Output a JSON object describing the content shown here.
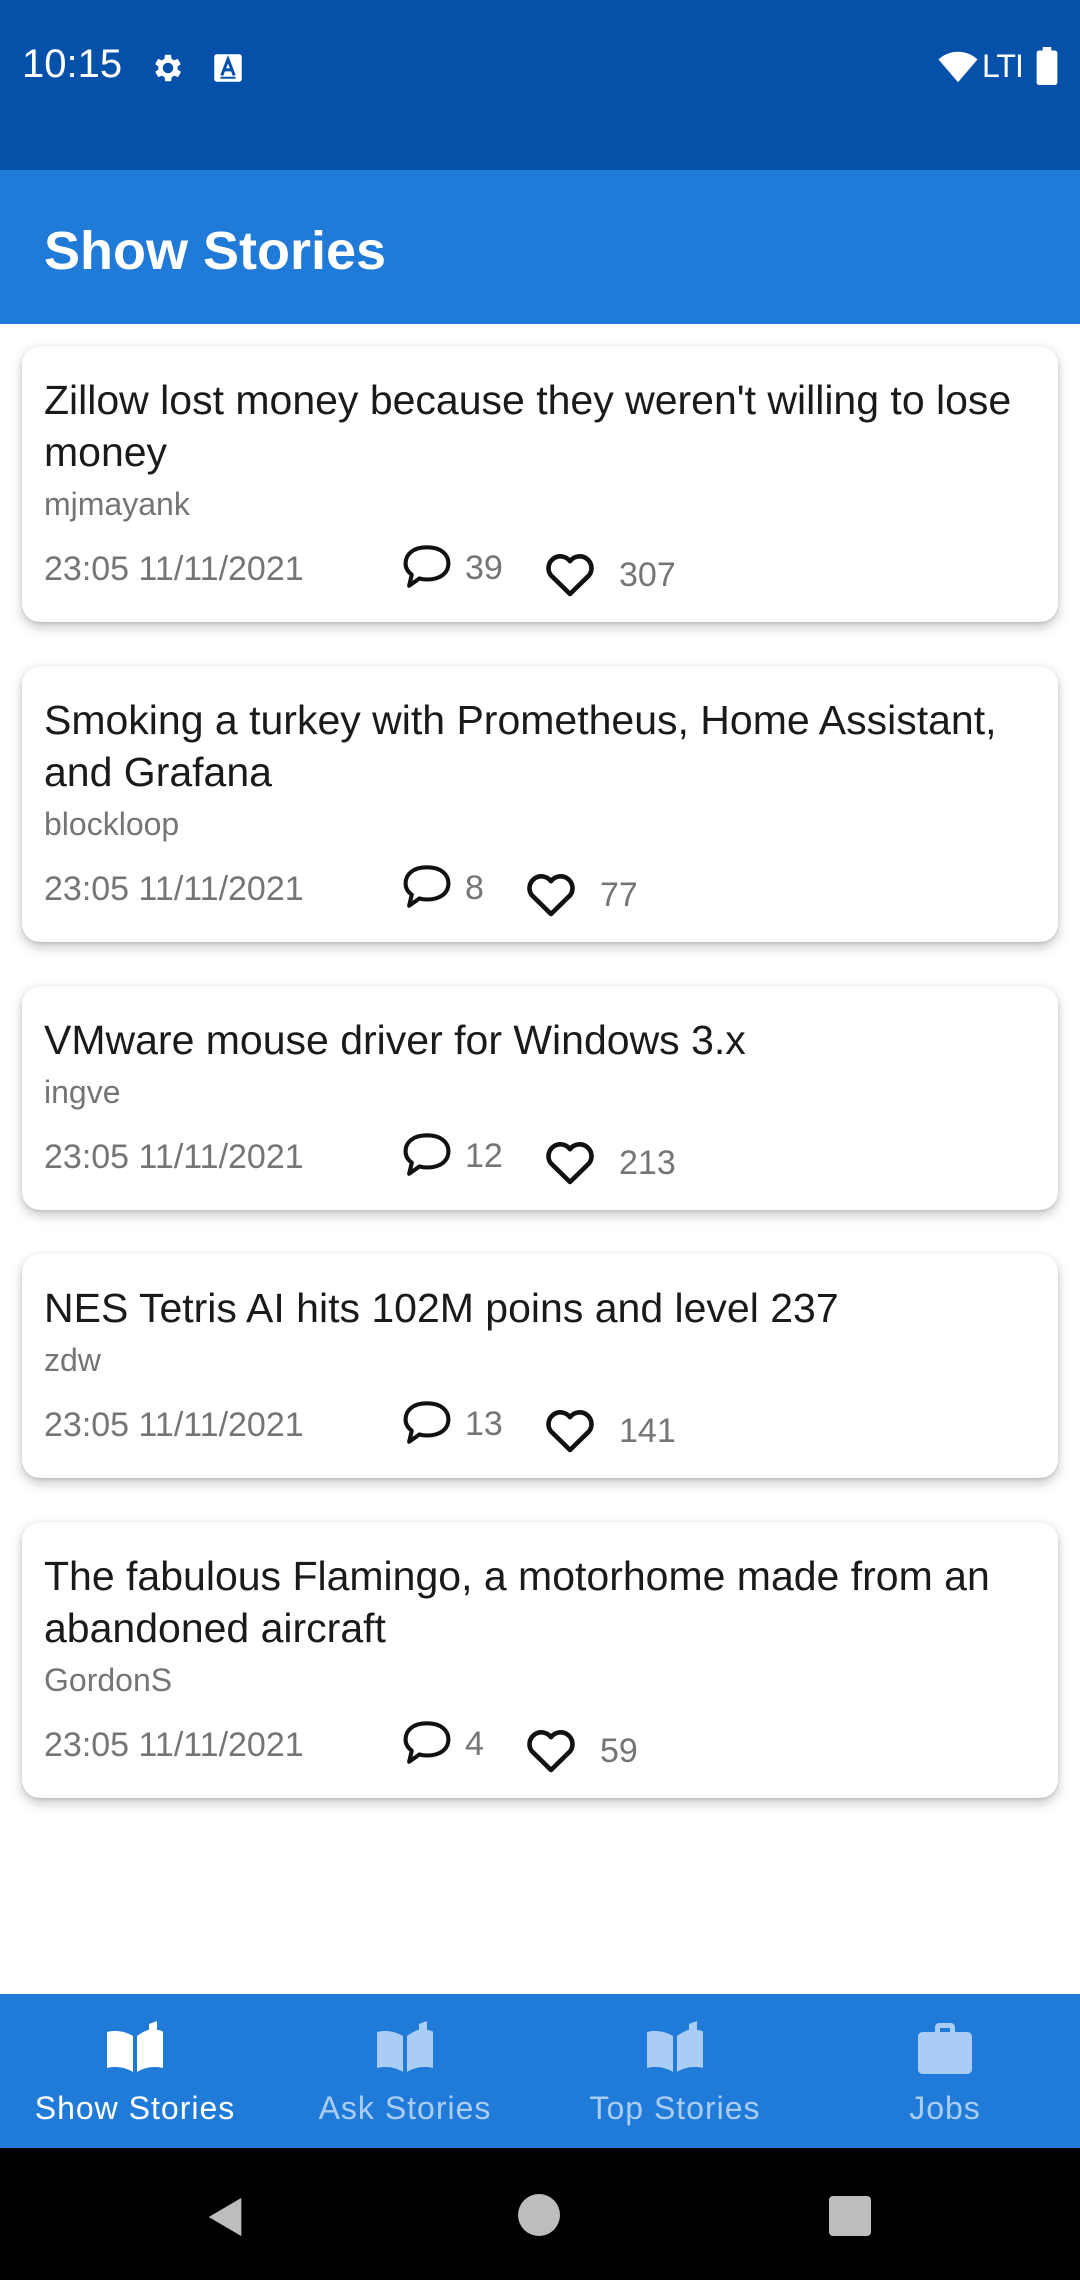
{
  "status_bar": {
    "time": "10:15",
    "network": "LTI",
    "icons": [
      "gear-icon",
      "a-box-icon",
      "wifi-icon",
      "battery-icon"
    ]
  },
  "app_bar": {
    "title": "Show Stories"
  },
  "stories": [
    {
      "title": "Zillow lost money because they weren't willing to lose money",
      "author": "mjmayank",
      "time": "23:05 11/11/2021",
      "comments": "39",
      "likes": "307"
    },
    {
      "title": "Smoking a turkey with Prometheus, Home Assistant, and Grafana",
      "author": "blockloop",
      "time": "23:05 11/11/2021",
      "comments": "8",
      "likes": "77"
    },
    {
      "title": "VMware mouse driver for Windows 3.x",
      "author": "ingve",
      "time": "23:05 11/11/2021",
      "comments": "12",
      "likes": "213"
    },
    {
      "title": "NES Tetris AI hits 102M poins and level 237",
      "author": "zdw",
      "time": "23:05 11/11/2021",
      "comments": "13",
      "likes": "141"
    },
    {
      "title": "The fabulous Flamingo, a motorhome made from an abandoned aircraft",
      "author": "GordonS",
      "time": "23:05 11/11/2021",
      "comments": "4",
      "likes": "59"
    }
  ],
  "bottom_nav": {
    "items": [
      {
        "label": "Show Stories",
        "icon": "book-open-icon",
        "active": true
      },
      {
        "label": "Ask Stories",
        "icon": "book-open-icon",
        "active": false
      },
      {
        "label": "Top Stories",
        "icon": "book-open-icon",
        "active": false
      },
      {
        "label": "Jobs",
        "icon": "briefcase-icon",
        "active": false
      }
    ]
  },
  "colors": {
    "status_bar": "#0550a8",
    "primary": "#1f7ad8",
    "nav_active": "#ffffff",
    "nav_inactive": "#a9cdf5"
  }
}
